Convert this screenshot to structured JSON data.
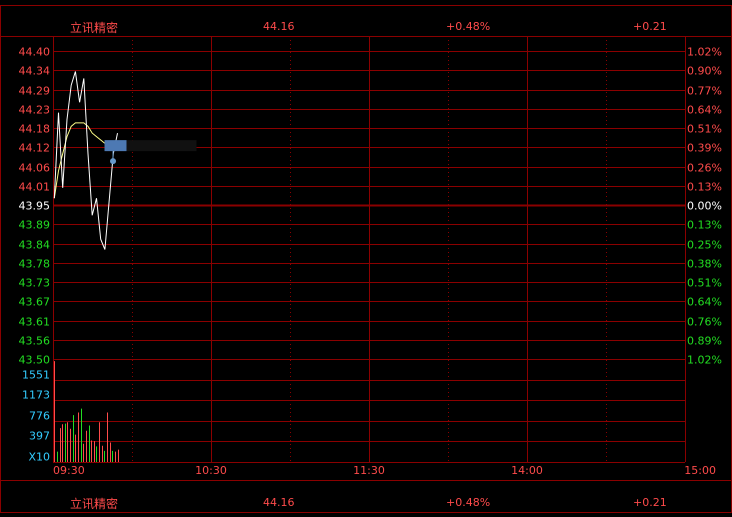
{
  "header": {
    "stock_name": "立讯精密",
    "price": "44.16",
    "change_pct": "+0.48%",
    "change": "+0.21"
  },
  "footer": {
    "stock_name": "立讯精密",
    "price": "44.16",
    "change_pct": "+0.48%",
    "change": "+0.21"
  },
  "colors": {
    "background": "#000000",
    "grid": "#8b0000",
    "up": "#ff4b4b",
    "down": "#22dd22",
    "neutral": "#ffffff",
    "volume_label": "#33ccff",
    "time_label": "#ff4b4b",
    "price_line": "#ffffff",
    "avg_line": "#ffff88"
  },
  "chart_data": {
    "type": "line",
    "prev_close": 43.95,
    "price_ticks": [
      "44.40",
      "44.34",
      "44.29",
      "44.23",
      "44.18",
      "44.12",
      "44.06",
      "44.01",
      "43.95",
      "43.89",
      "43.84",
      "43.78",
      "43.73",
      "43.67",
      "43.61",
      "43.56",
      "43.50"
    ],
    "pct_ticks": [
      "1.02%",
      "0.90%",
      "0.77%",
      "0.64%",
      "0.51%",
      "0.39%",
      "0.26%",
      "0.13%",
      "0.00%",
      "0.13%",
      "0.25%",
      "0.38%",
      "0.51%",
      "0.64%",
      "0.76%",
      "0.89%",
      "1.02%"
    ],
    "ylim": [
      43.5,
      44.4
    ],
    "time_ticks": [
      "09:30",
      "10:30",
      "11:30",
      "14:00",
      "15:00"
    ],
    "volume_ticks": [
      "1551",
      "1173",
      "776",
      "397",
      "X10"
    ],
    "volume_unit": "X10",
    "volume_max": 1551,
    "total_minutes": 240,
    "minutes_shown": 25,
    "price_series": [
      43.97,
      44.22,
      44.0,
      44.2,
      44.3,
      44.34,
      44.25,
      44.32,
      44.1,
      43.92,
      43.97,
      43.85,
      43.82,
      43.96,
      44.1,
      44.16
    ],
    "avg_series": [
      43.97,
      44.05,
      44.1,
      44.15,
      44.18,
      44.19,
      44.19,
      44.19,
      44.18,
      44.16,
      44.15,
      44.14,
      44.13,
      44.12,
      44.12,
      44.12
    ],
    "volume_series": [
      1550,
      160,
      520,
      580,
      590,
      610,
      510,
      720,
      420,
      760,
      820,
      280,
      480,
      560,
      330,
      320,
      240,
      610,
      250,
      170,
      760,
      300,
      170,
      160,
      190
    ]
  }
}
